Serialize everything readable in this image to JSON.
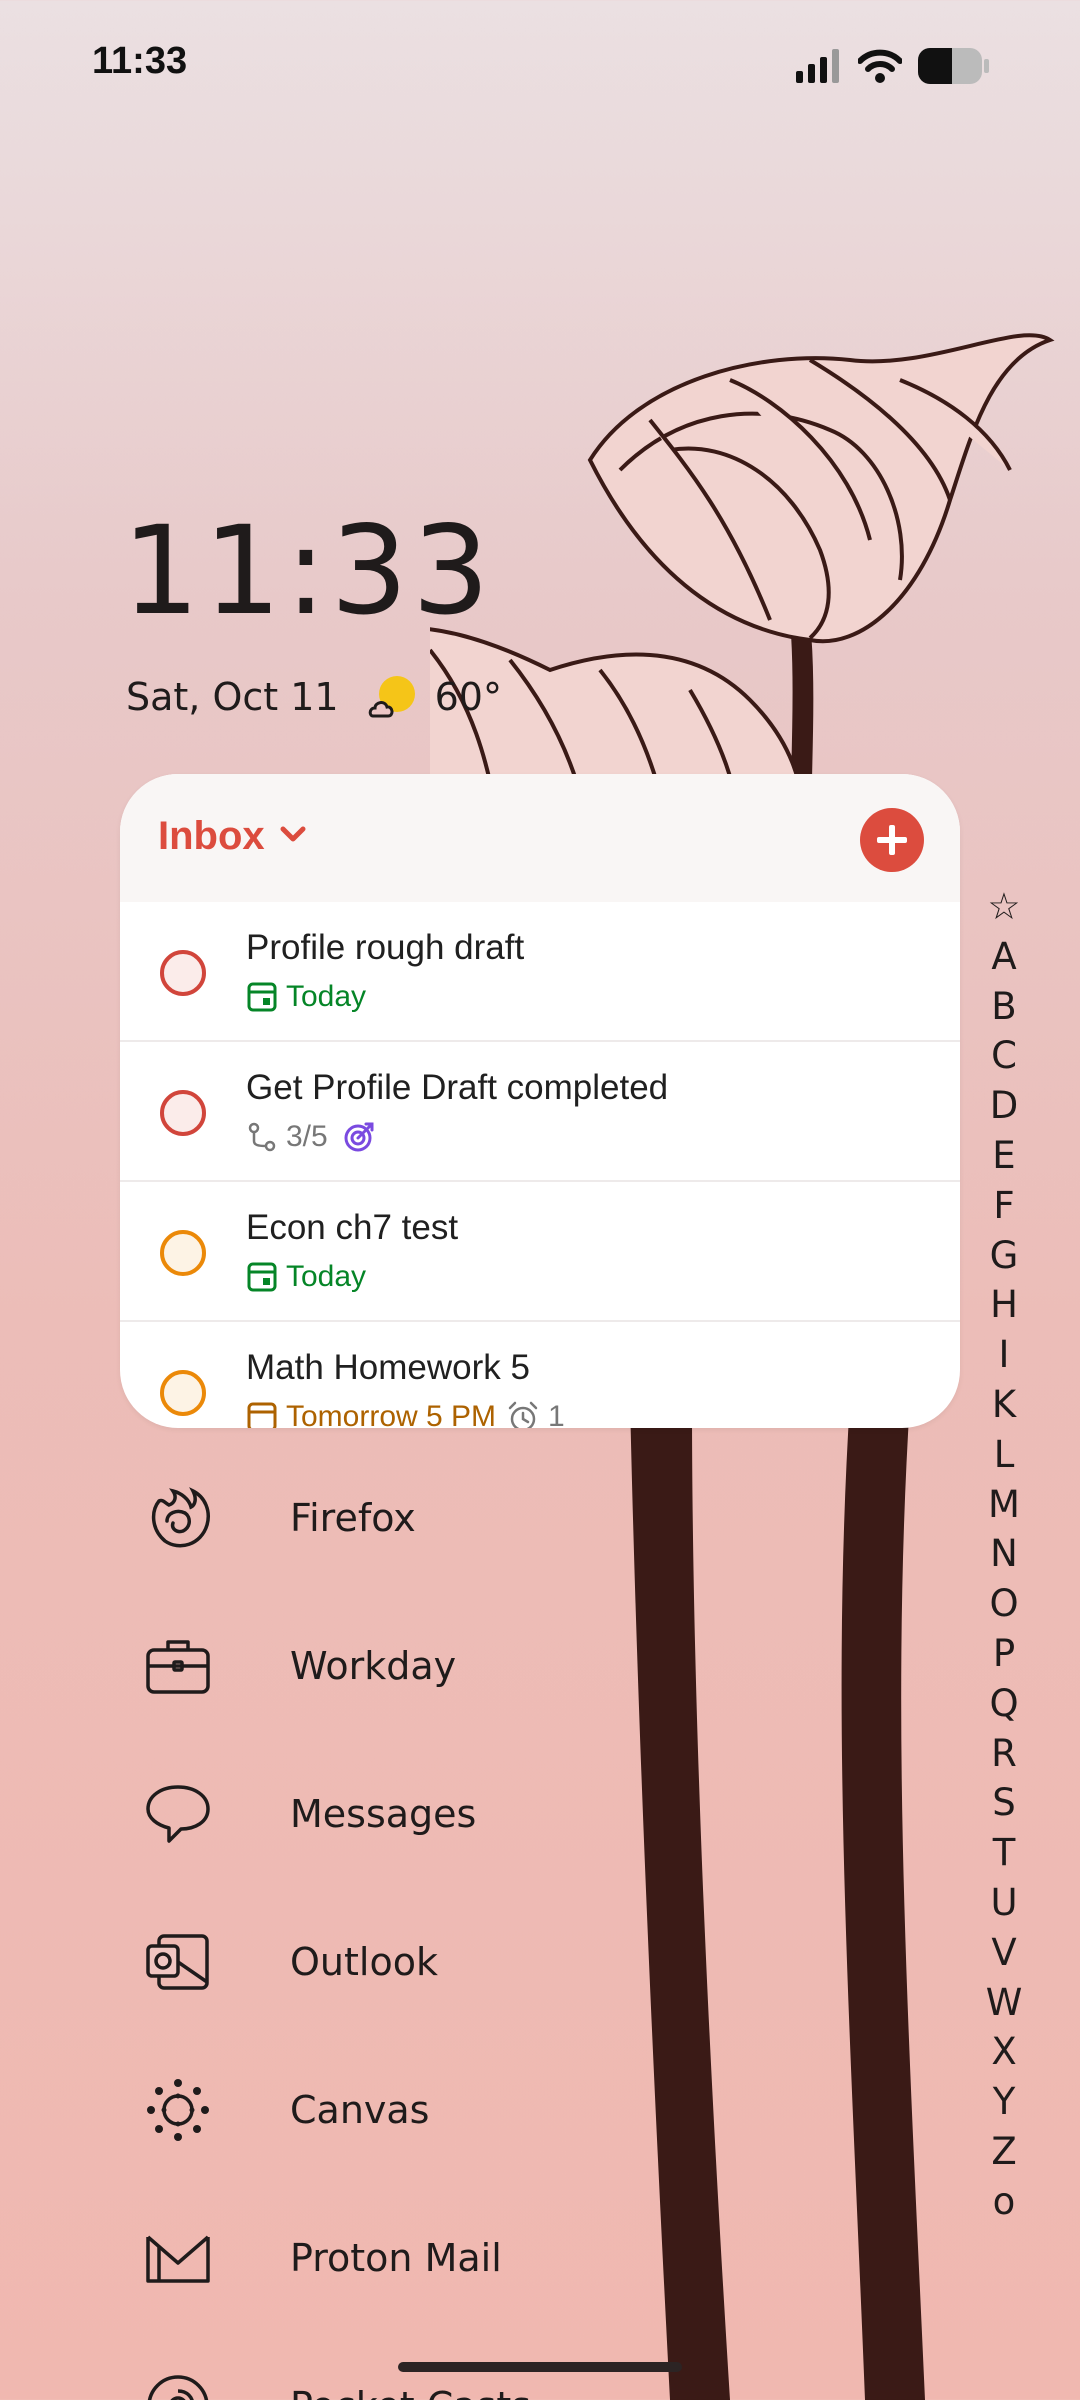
{
  "status_bar": {
    "time": "11:33"
  },
  "clock": {
    "time": "11:33",
    "date": "Sat, Oct 11",
    "temperature": "60°",
    "weather_icon": "partly-cloudy-icon"
  },
  "widget": {
    "project": "Inbox",
    "tasks": [
      {
        "title": "Profile rough draft",
        "due": "Today",
        "priority_color": "#d1453b"
      },
      {
        "title": "Get Profile Draft completed",
        "subtasks": "3/5",
        "priority_color": "#d1453b"
      },
      {
        "title": "Econ ch7 test",
        "due": "Today",
        "priority_color": "#eb8909"
      },
      {
        "title": "Math Homework 5",
        "due": "Tomorrow 5 PM",
        "reminders": "1",
        "priority_color": "#eb8909"
      }
    ]
  },
  "apps": [
    {
      "label": "Firefox",
      "icon": "firefox-icon"
    },
    {
      "label": "Workday",
      "icon": "briefcase-icon"
    },
    {
      "label": "Messages",
      "icon": "chat-bubble-icon"
    },
    {
      "label": "Outlook",
      "icon": "outlook-icon"
    },
    {
      "label": "Canvas",
      "icon": "canvas-icon"
    },
    {
      "label": "Proton Mail",
      "icon": "mail-icon"
    },
    {
      "label": "Pocket Casts",
      "icon": "pocket-casts-icon"
    }
  ],
  "alphabet_index": [
    "☆",
    "A",
    "B",
    "C",
    "D",
    "E",
    "F",
    "G",
    "H",
    "I",
    "K",
    "L",
    "M",
    "N",
    "O",
    "P",
    "Q",
    "R",
    "S",
    "T",
    "U",
    "V",
    "W",
    "X",
    "Y",
    "Z",
    "o"
  ],
  "colors": {
    "accent": "#dc4c3e",
    "due_today": "#058527",
    "due_tomorrow": "#ad6200",
    "flower": "#3a1a16"
  }
}
